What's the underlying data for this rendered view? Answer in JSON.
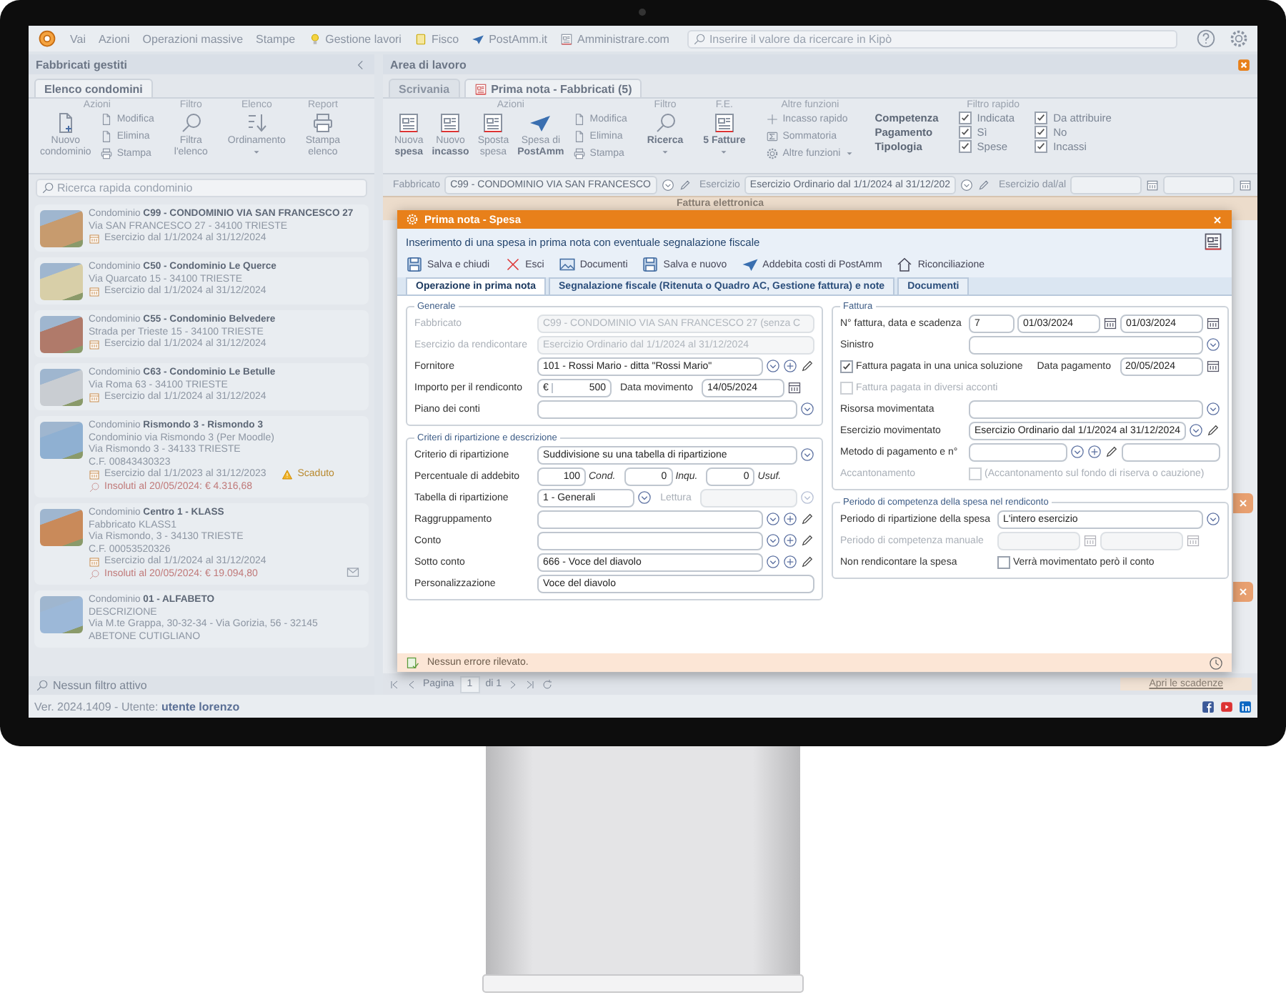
{
  "menu": {
    "items": [
      {
        "label": "Vai"
      },
      {
        "label": "Azioni"
      },
      {
        "label": "Operazioni massive"
      },
      {
        "label": "Stampe"
      },
      {
        "label": "Gestione lavori"
      },
      {
        "label": "Fisco"
      },
      {
        "label": "PostAmm.it"
      },
      {
        "label": "Amministrare.com"
      }
    ],
    "search": {
      "placeholder": "Inserire il valore da ricercare in Kipò"
    }
  },
  "left_panel": {
    "title": "Fabbricati gestiti",
    "tabs": [
      {
        "label": "Elenco condomini",
        "selected": true
      }
    ],
    "ribbon": [
      {
        "kind": "buttons",
        "title": "Azioni",
        "buttons": [
          {
            "kind": "large",
            "lines": [
              {
                "text": "Nuovo",
                "bold": false
              },
              {
                "text": "condominio",
                "bold": false
              }
            ],
            "dropdown": false
          },
          {
            "kind": "small",
            "lines": [
              {
                "text": "Modifica",
                "bold": false
              }
            ],
            "dropdown": false
          },
          {
            "kind": "small",
            "lines": [
              {
                "text": "Elimina",
                "bold": false
              }
            ],
            "dropdown": false
          },
          {
            "kind": "small",
            "lines": [
              {
                "text": "Stampa",
                "bold": false
              }
            ],
            "dropdown": false
          }
        ]
      },
      {
        "kind": "buttons",
        "title": "Filtro",
        "buttons": [
          {
            "kind": "large",
            "lines": [
              {
                "text": "Filtra",
                "bold": false
              },
              {
                "text": "l'elenco",
                "bold": false
              }
            ],
            "dropdown": false
          }
        ]
      },
      {
        "kind": "buttons",
        "title": "Elenco",
        "buttons": [
          {
            "kind": "large",
            "lines": [
              {
                "text": "Ordinamento",
                "bold": false
              }
            ],
            "dropdown": true
          }
        ]
      },
      {
        "kind": "buttons",
        "title": "Report",
        "buttons": [
          {
            "kind": "large",
            "lines": [
              {
                "text": "Stampa",
                "bold": false
              },
              {
                "text": "elenco",
                "bold": false
              }
            ],
            "dropdown": false
          }
        ]
      }
    ],
    "search": {
      "placeholder": "Ricerca rapida condominio"
    },
    "condomini": [
      {
        "title": "Condominio **C99 - CONDOMINIO VIA SAN FRANCESCO 27**",
        "lines": [
          {
            "kind": "plain",
            "text": "Via SAN FRANCESCO 27 - 34100 TRIESTE"
          },
          {
            "kind": "period",
            "text": "Esercizio dal 1/1/2024 al 31/12/2024"
          }
        ],
        "mail": false
      },
      {
        "title": "Condominio **C50 - Condominio Le Querce**",
        "lines": [
          {
            "kind": "plain",
            "text": "Via Quarcato 15 - 34100 TRIESTE"
          },
          {
            "kind": "period",
            "text": "Esercizio dal 1/1/2024 al 31/12/2024"
          }
        ],
        "mail": false
      },
      {
        "title": "Condominio **C55 - Condominio Belvedere**",
        "lines": [
          {
            "kind": "plain",
            "text": "Strada per Trieste 15 - 34100 TRIESTE"
          },
          {
            "kind": "period",
            "text": "Esercizio dal 1/1/2024 al 31/12/2024"
          }
        ],
        "mail": false
      },
      {
        "title": "Condominio **C63 - Condominio Le Betulle**",
        "lines": [
          {
            "kind": "plain",
            "text": "Via Roma 63 - 34100 TRIESTE"
          },
          {
            "kind": "period",
            "text": "Esercizio dal 1/1/2024 al 31/12/2024"
          }
        ],
        "mail": false
      },
      {
        "title": "Condominio **Rismondo 3 - Rismondo 3**",
        "lines": [
          {
            "kind": "plain",
            "text": "Condominio via Rismondo 3 (Per Moodle)"
          },
          {
            "kind": "plain",
            "text": "Via Rismondo 3 - 34133 TRIESTE"
          },
          {
            "kind": "plain",
            "text": "C.F. 00843430323"
          },
          {
            "kind": "period",
            "text": "Esercizio dal 1/1/2023 al 31/12/2023",
            "badge": "Scaduto"
          },
          {
            "kind": "debt",
            "text": "Insoluti al 20/05/2024: € 4.316,68"
          }
        ],
        "mail": false
      },
      {
        "title": "Condominio **Centro 1 - KLASS**",
        "lines": [
          {
            "kind": "plain",
            "text": "Fabbricato KLASS1"
          },
          {
            "kind": "plain",
            "text": "Via Rismondo, 3 - 34130 TRIESTE"
          },
          {
            "kind": "plain",
            "text": "C.F. 00053520326"
          },
          {
            "kind": "period",
            "text": "Esercizio dal 1/1/2024 al 31/12/2024"
          },
          {
            "kind": "debt",
            "text": "Insoluti al 20/05/2024: € 19.094,80"
          }
        ],
        "mail": true
      },
      {
        "title": "Condominio **01 - ALFABETO**",
        "lines": [
          {
            "kind": "plain",
            "text": "DESCRIZIONE"
          },
          {
            "kind": "plain",
            "text": "Via M.te Grappa, 30-32-34 - Via Gorizia, 56 - 32145 ABETONE CUTIGLIANO"
          }
        ],
        "mail": false
      }
    ],
    "footer": "Nessun filtro attivo"
  },
  "work_area": {
    "title": "Area di lavoro",
    "tabs": [
      {
        "label": "Scrivania",
        "selected": false
      },
      {
        "label": "Prima nota - Fabbricati (5)",
        "selected": true
      }
    ],
    "ribbon": [
      {
        "kind": "buttons",
        "title": "Azioni",
        "buttons": [
          {
            "kind": "large",
            "lines": [
              {
                "text": "Nuova",
                "bold": false
              },
              {
                "text": "spesa",
                "bold": true
              }
            ],
            "dropdown": false
          },
          {
            "kind": "large",
            "lines": [
              {
                "text": "Nuovo",
                "bold": false
              },
              {
                "text": "incasso",
                "bold": true
              }
            ],
            "dropdown": false
          },
          {
            "kind": "large",
            "lines": [
              {
                "text": "Sposta",
                "bold": false
              },
              {
                "text": "spesa",
                "bold": false
              }
            ],
            "dropdown": false
          },
          {
            "kind": "large",
            "lines": [
              {
                "text": "Spesa di",
                "bold": false
              },
              {
                "text": "PostAmm",
                "bold": true
              }
            ],
            "dropdown": false
          },
          {
            "kind": "small",
            "lines": [
              {
                "text": "Modifica",
                "bold": false
              }
            ],
            "dropdown": false
          },
          {
            "kind": "small",
            "lines": [
              {
                "text": "Elimina",
                "bold": false
              }
            ],
            "dropdown": false
          },
          {
            "kind": "small",
            "lines": [
              {
                "text": "Stampa",
                "bold": false
              }
            ],
            "dropdown": false
          }
        ]
      },
      {
        "kind": "buttons",
        "title": "Filtro",
        "buttons": [
          {
            "kind": "large",
            "lines": [
              {
                "text": "Ricerca",
                "bold": true
              }
            ],
            "dropdown": true
          }
        ]
      },
      {
        "kind": "buttons",
        "title": "F.E.",
        "buttons": [
          {
            "kind": "large",
            "lines": [
              {
                "text": "5 Fatture",
                "bold": true
              }
            ],
            "dropdown": true
          }
        ]
      },
      {
        "kind": "buttons",
        "title": "Altre funzioni",
        "buttons": [
          {
            "kind": "small",
            "lines": [
              {
                "text": "Incasso rapido",
                "bold": false
              }
            ],
            "dropdown": false
          },
          {
            "kind": "small",
            "lines": [
              {
                "text": "Sommatoria",
                "bold": false
              }
            ],
            "dropdown": false
          },
          {
            "kind": "small",
            "lines": [
              {
                "text": "Altre funzioni",
                "bold": false
              }
            ],
            "dropdown": true
          }
        ]
      },
      {
        "kind": "filters",
        "title": "Filtro rapido",
        "rows": [
          {
            "label": "Competenza",
            "options": [
              {
                "label": "Indicata",
                "checked": true
              },
              {
                "label": "Da attribuire",
                "checked": true
              }
            ]
          },
          {
            "label": "Pagamento",
            "options": [
              {
                "label": "Sì",
                "checked": true
              },
              {
                "label": "No",
                "checked": true
              }
            ]
          },
          {
            "label": "Tipologia",
            "options": [
              {
                "label": "Spese",
                "checked": true
              },
              {
                "label": "Incassi",
                "checked": true
              }
            ]
          }
        ]
      }
    ],
    "filter_bar": {
      "fabbricato": {
        "label": "Fabbricato",
        "value": "C99 - CONDOMINIO VIA SAN FRANCESCO"
      },
      "esercizio": {
        "label": "Esercizio",
        "value": "Esercizio Ordinario dal 1/1/2024 al 31/12/202"
      },
      "range": {
        "label": "Esercizio dal/al"
      }
    },
    "table": {
      "group_header": "Fattura elettronica"
    },
    "pager": {
      "label": "Pagina",
      "page": "1",
      "total": "di 1"
    },
    "deadlines_link": "Apri le scadenze"
  },
  "modal": {
    "title": "Prima nota - Spesa",
    "subtitle": "Inserimento di una spesa in prima nota con eventuale segnalazione fiscale",
    "toolbar": [
      {
        "label": "Salva e chiudi"
      },
      {
        "label": "Esci"
      },
      {
        "label": "Documenti"
      },
      {
        "label": "Salva e nuovo"
      },
      {
        "label": "Addebita costi di PostAmm"
      },
      {
        "label": "Riconciliazione"
      }
    ],
    "tabs": [
      {
        "label": "Operazione in prima nota",
        "selected": true
      },
      {
        "label": "Segnalazione fiscale (Ritenuta o Quadro AC, Gestione fattura) e note",
        "selected": false
      },
      {
        "label": "Documenti",
        "selected": false
      }
    ],
    "columns": [
      {
        "fieldsets": [
          {
            "legend": "Generale",
            "rows": [
              {
                "label": "Fabbricato",
                "disabled": true,
                "fields": [
                  {
                    "kind": "text",
                    "value": "C99 - CONDOMINIO VIA SAN FRANCESCO 27 (senza C",
                    "disabled": true
                  }
                ]
              },
              {
                "label": "Esercizio da rendicontare",
                "disabled": true,
                "fields": [
                  {
                    "kind": "text",
                    "value": "Esercizio Ordinario dal 1/1/2024 al 31/12/2024",
                    "disabled": true
                  }
                ]
              },
              {
                "label": "Fornitore",
                "disabled": false,
                "fields": [
                  {
                    "kind": "lookup",
                    "value": "101 - Rossi Mario - ditta \"Rossi Mario\"",
                    "disabled": false
                  }
                ]
              },
              {
                "label": "Importo per il rendiconto",
                "disabled": false,
                "fields": [
                  {
                    "kind": "amount",
                    "currency": "€",
                    "value": "500",
                    "disabled": false
                  },
                  {
                    "kind": "caption",
                    "text": "Data movimento",
                    "disabled": false
                  },
                  {
                    "kind": "date",
                    "value": "14/05/2024",
                    "disabled": false
                  }
                ]
              },
              {
                "label": "Piano dei conti",
                "disabled": false,
                "fields": [
                  {
                    "kind": "select",
                    "disabled": false
                  }
                ]
              }
            ]
          },
          {
            "legend": "Criteri di ripartizione e descrizione",
            "rows": [
              {
                "label": "Criterio di ripartizione",
                "disabled": false,
                "fields": [
                  {
                    "kind": "select",
                    "value": "Suddivisione su una tabella di ripartizione",
                    "disabled": false
                  }
                ]
              },
              {
                "label": "Percentuale di addebito",
                "disabled": false,
                "fields": [
                  {
                    "kind": "number",
                    "value": "100",
                    "disabled": false
                  },
                  {
                    "kind": "unit",
                    "text": "Cond.",
                    "disabled": false
                  },
                  {
                    "kind": "number",
                    "value": "0",
                    "disabled": false
                  },
                  {
                    "kind": "unit",
                    "text": "Inqu.",
                    "disabled": false
                  },
                  {
                    "kind": "number",
                    "value": "0",
                    "disabled": false
                  },
                  {
                    "kind": "unit",
                    "text": "Usuf.",
                    "disabled": false
                  }
                ]
              },
              {
                "label": "Tabella di ripartizione",
                "disabled": false,
                "fields": [
                  {
                    "kind": "select",
                    "value": "1 - Generali",
                    "disabled": false
                  },
                  {
                    "kind": "caption",
                    "text": "Lettura",
                    "disabled": true
                  },
                  {
                    "kind": "select",
                    "disabled": true
                  }
                ]
              },
              {
                "label": "Raggruppamento",
                "disabled": false,
                "fields": [
                  {
                    "kind": "lookup",
                    "disabled": false
                  }
                ]
              },
              {
                "label": "Conto",
                "disabled": false,
                "fields": [
                  {
                    "kind": "lookup",
                    "disabled": false
                  }
                ]
              },
              {
                "label": "Sotto conto",
                "disabled": false,
                "fields": [
                  {
                    "kind": "lookup",
                    "value": "666 - Voce del diavolo",
                    "disabled": false
                  }
                ]
              },
              {
                "label": "Personalizzazione",
                "disabled": false,
                "fields": [
                  {
                    "kind": "text",
                    "value": "Voce del diavolo",
                    "disabled": false
                  }
                ]
              }
            ]
          }
        ]
      },
      {
        "fieldsets": [
          {
            "legend": "Fattura",
            "rows": [
              {
                "label": "N° fattura, data e scadenza",
                "disabled": false,
                "fields": [
                  {
                    "kind": "text",
                    "value": "7",
                    "disabled": false
                  },
                  {
                    "kind": "date",
                    "value": "01/03/2024",
                    "disabled": false
                  },
                  {
                    "kind": "date",
                    "value": "01/03/2024",
                    "disabled": false
                  }
                ]
              },
              {
                "label": "Sinistro",
                "disabled": false,
                "fields": [
                  {
                    "kind": "select",
                    "disabled": false
                  }
                ]
              },
              {
                "fields": [
                  {
                    "kind": "check",
                    "label": "Fattura pagata in una unica soluzione",
                    "checked": true,
                    "disabled": false
                  },
                  {
                    "kind": "caption",
                    "text": "Data pagamento",
                    "disabled": false
                  },
                  {
                    "kind": "date",
                    "value": "20/05/2024",
                    "disabled": false
                  }
                ]
              },
              {
                "fields": [
                  {
                    "kind": "check",
                    "label": "Fattura pagata in diversi acconti",
                    "checked": false,
                    "disabled": true
                  }
                ]
              },
              {
                "label": "Risorsa movimentata",
                "disabled": false,
                "fields": [
                  {
                    "kind": "select",
                    "disabled": false
                  }
                ]
              },
              {
                "label": "Esercizio movimentato",
                "disabled": false,
                "fields": [
                  {
                    "kind": "select-edit",
                    "value": "Esercizio Ordinario dal 1/1/2024 al 31/12/2024",
                    "disabled": false
                  }
                ]
              },
              {
                "label": "Metodo di pagamento e n°",
                "disabled": false,
                "fields": [
                  {
                    "kind": "lookup",
                    "disabled": false
                  },
                  {
                    "kind": "text",
                    "disabled": false
                  }
                ]
              },
              {
                "label": "Accantonamento",
                "disabled": true,
                "fields": [
                  {
                    "kind": "check",
                    "label": "(Accantonamento sul fondo di riserva o cauzione)",
                    "checked": false,
                    "disabled": true
                  }
                ]
              }
            ]
          },
          {
            "legend": "Periodo di competenza della spesa nel rendiconto",
            "rows": [
              {
                "label": "Periodo di ripartizione della spesa",
                "disabled": false,
                "fields": [
                  {
                    "kind": "select",
                    "value": "L'intero esercizio",
                    "disabled": false
                  }
                ]
              },
              {
                "label": "Periodo di competenza manuale",
                "disabled": true,
                "fields": [
                  {
                    "kind": "date",
                    "disabled": true
                  },
                  {
                    "kind": "date",
                    "disabled": true
                  }
                ]
              },
              {
                "label": "Non rendicontare la spesa",
                "disabled": false,
                "fields": [
                  {
                    "kind": "check",
                    "label": "Verrà movimentato però il conto",
                    "checked": false,
                    "disabled": false
                  }
                ]
              }
            ]
          }
        ]
      }
    ],
    "status": "Nessun errore rilevato."
  },
  "status_bar": {
    "text": "Ver. 2024.1409 - Utente: **utente lorenzo**"
  }
}
